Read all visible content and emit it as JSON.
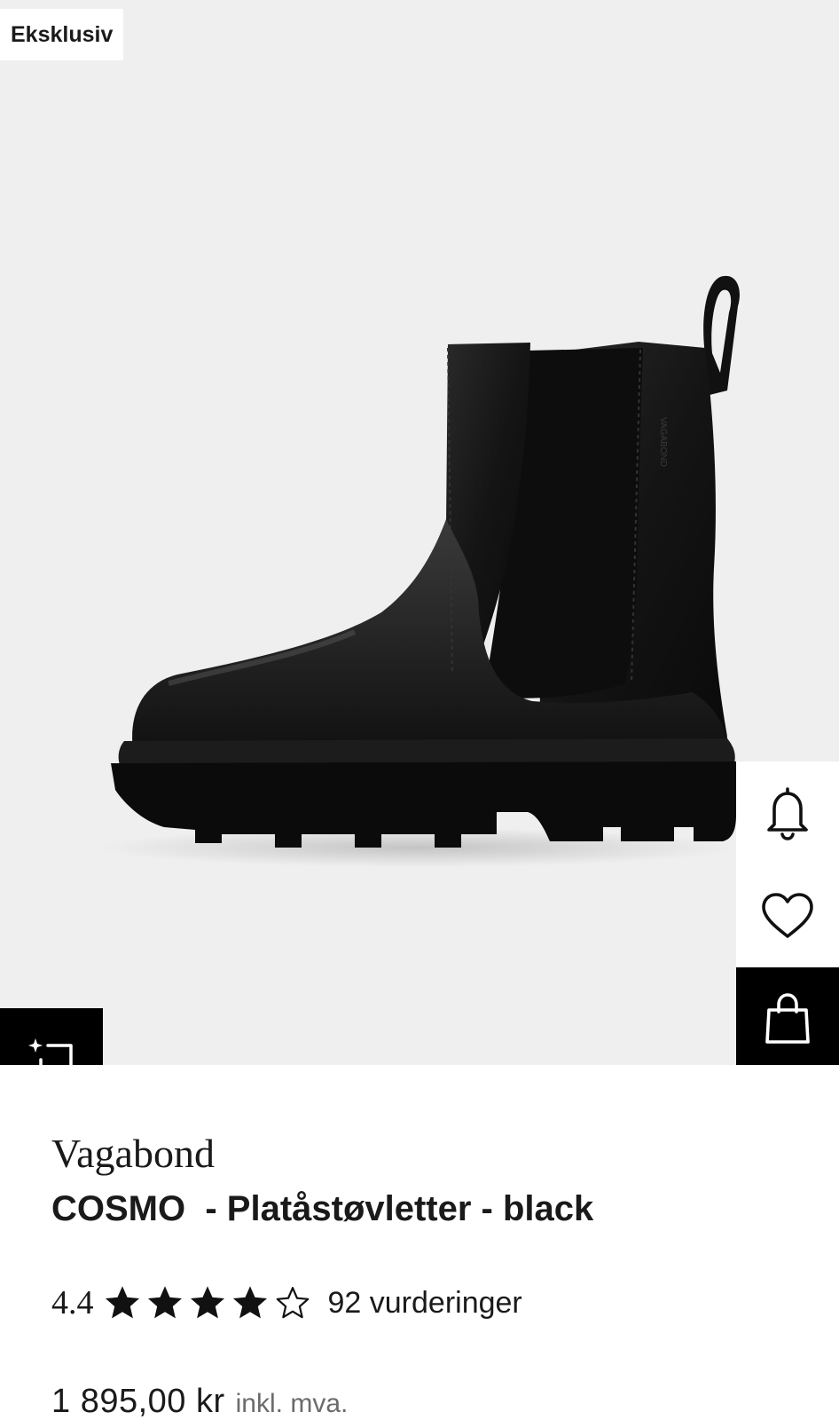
{
  "product": {
    "badge": "Eksklusiv",
    "brand": "Vagabond",
    "name": "COSMO  - Platåstøvletter - black",
    "rating": {
      "value": "4.4",
      "stars_filled": 4,
      "stars_total": 5,
      "review_count_label": "92 vurderinger"
    },
    "price": "1 895,00 kr",
    "price_note": "inkl. mva."
  },
  "actions": [
    {
      "name": "notify",
      "icon": "bell-icon"
    },
    {
      "name": "wishlist",
      "icon": "heart-icon"
    },
    {
      "name": "add-to-bag",
      "icon": "shopping-bag-icon"
    }
  ],
  "similar": {
    "icon": "find-similar-icon"
  },
  "colors": {
    "hero_background": "#efefef",
    "text": "#1a1a1a",
    "muted_text": "#6b6b6b",
    "dark_button": "#000000"
  }
}
